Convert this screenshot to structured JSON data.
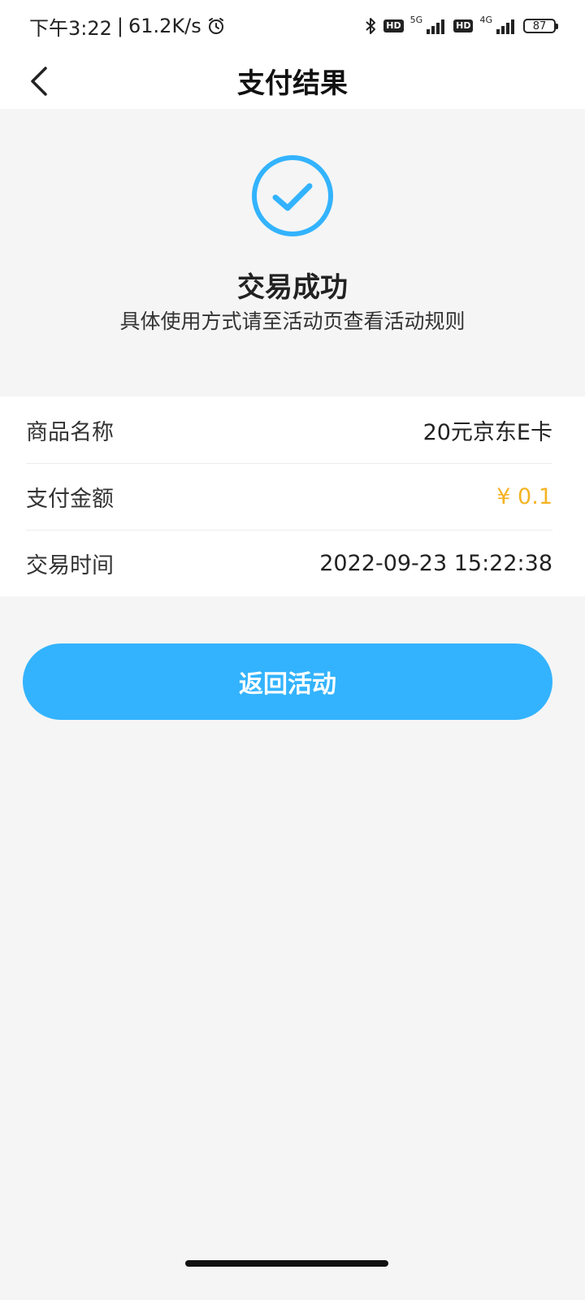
{
  "status_bar": {
    "time": "下午3:22",
    "separator": "|",
    "net_speed": "61.2K/s",
    "net1": "5G",
    "net2": "4G",
    "hd": "HD",
    "battery": "87"
  },
  "nav": {
    "title": "支付结果"
  },
  "result": {
    "title": "交易成功",
    "subtitle": "具体使用方式请至活动页查看活动规则"
  },
  "details": [
    {
      "label": "商品名称",
      "value": "20元京东E卡"
    },
    {
      "label": "支付金额",
      "value": "¥ 0.1"
    },
    {
      "label": "交易时间",
      "value": "2022-09-23 15:22:38"
    }
  ],
  "actions": {
    "return_label": "返回活动"
  },
  "colors": {
    "accent": "#33b3fe",
    "amount": "#f5b323",
    "background": "#f5f5f5"
  }
}
